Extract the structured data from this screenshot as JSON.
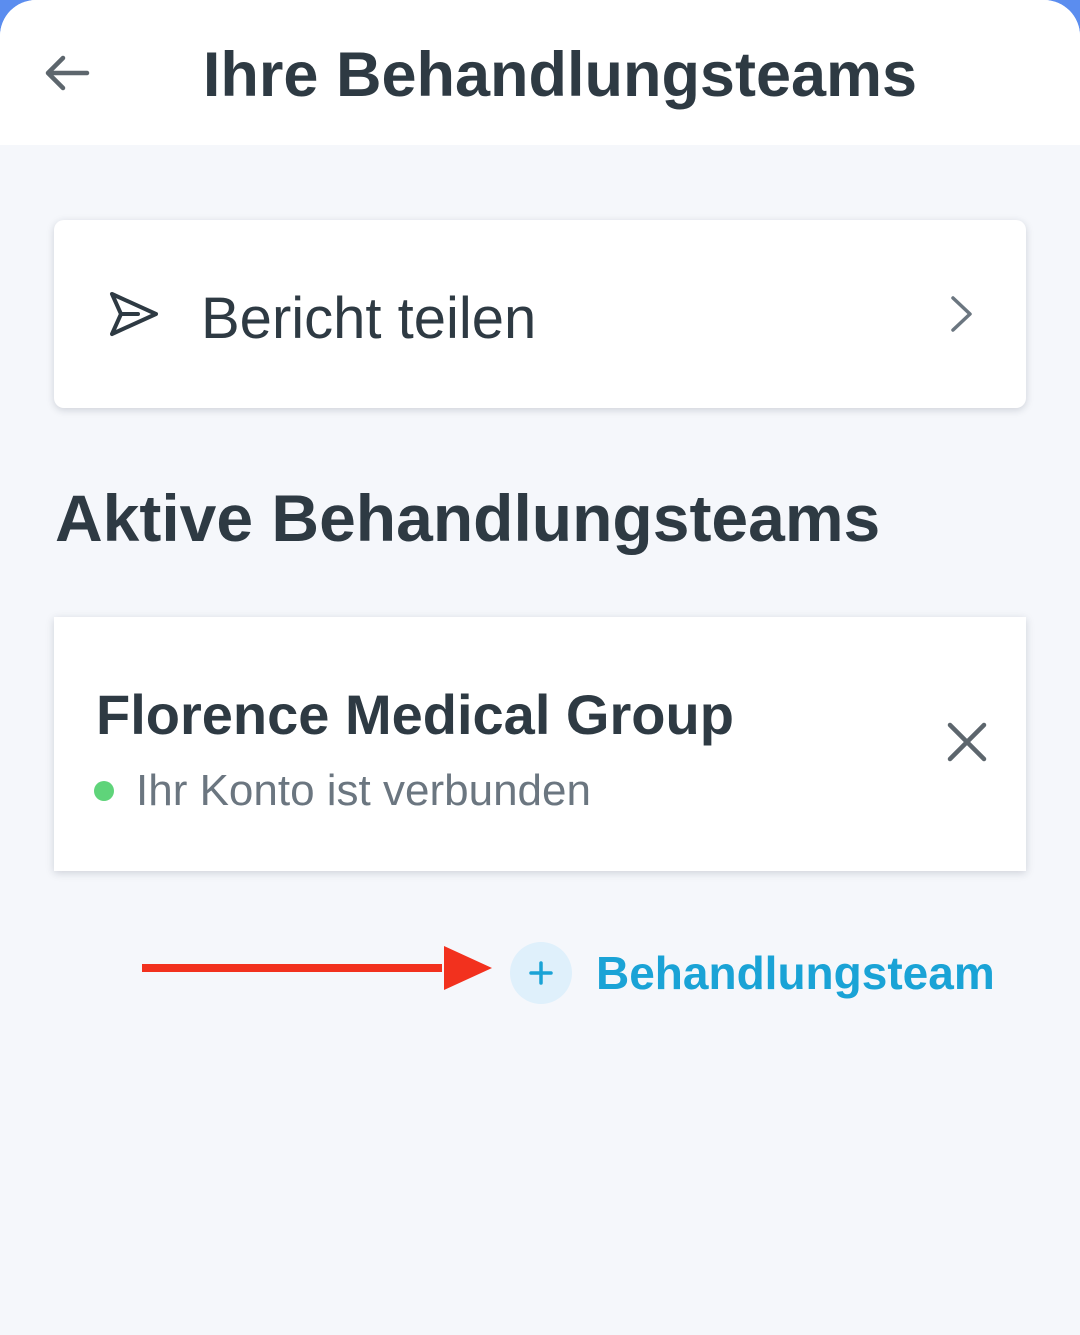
{
  "header": {
    "title": "Ihre Behandlungsteams",
    "back_icon": "arrow-left-icon"
  },
  "share_report": {
    "label": "Bericht teilen",
    "icon": "paper-plane-icon",
    "chevron_icon": "chevron-right-icon"
  },
  "active_teams": {
    "heading": "Aktive Behandlungsteams",
    "teams": [
      {
        "name": "Florence Medical Group",
        "status": "Ihr Konto ist verbunden",
        "status_color": "#5fd47a",
        "remove_icon": "close-icon"
      }
    ]
  },
  "add_team": {
    "label": "Behandlungsteam",
    "icon": "plus-icon",
    "accent_color": "#1aa3d6"
  },
  "annotation": {
    "arrow_icon": "red-arrow-right-icon",
    "color": "#f2311e"
  }
}
